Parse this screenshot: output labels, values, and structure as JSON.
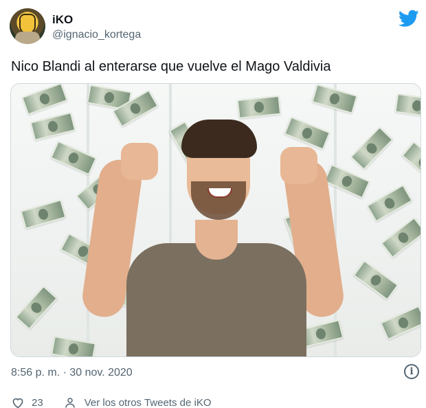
{
  "user": {
    "name": "iKO",
    "handle": "@ignacio_kortega"
  },
  "tweet": {
    "text": "Nico Blandi al enterarse que vuelve el Mago Valdivia",
    "timestamp": "8:56 p. m. · 30 nov. 2020"
  },
  "actions": {
    "like_count": "23",
    "more_tweets_label": "Ver los otros Tweets de iKO"
  },
  "icons": {
    "brand": "twitter-bird-icon",
    "info": "info-icon",
    "like": "heart-icon",
    "profile": "person-icon"
  },
  "colors": {
    "twitter_blue": "#1d9bf0",
    "secondary_text": "#536471"
  }
}
